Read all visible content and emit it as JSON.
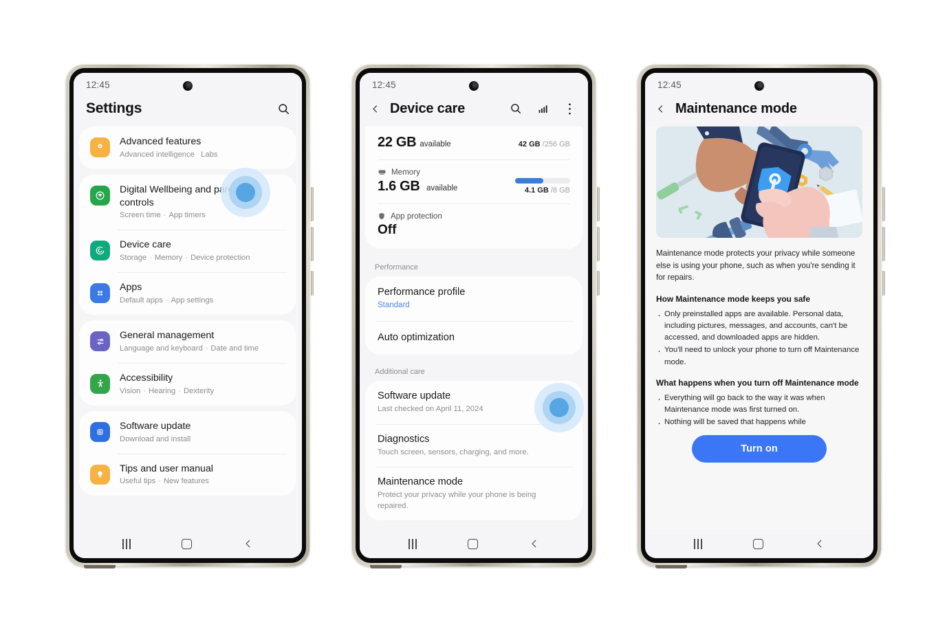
{
  "phones": [
    {
      "id": "settings",
      "status": {
        "time": "12:45"
      },
      "header": {
        "title": "Settings",
        "search_icon": "search-icon"
      },
      "groups": [
        {
          "rows": [
            {
              "title": "Advanced features",
              "sub": [
                "Advanced intelligence",
                "Labs"
              ],
              "sep": "   ",
              "icon": "advanced-features-icon",
              "color": "#f6b343"
            }
          ]
        },
        {
          "rows": [
            {
              "title": "Digital Wellbeing and parental controls",
              "sub": [
                "Screen time",
                "App timers"
              ],
              "sep": " · ",
              "icon": "digital-wellbeing-icon",
              "color": "#27a54b"
            },
            {
              "title": "Device care",
              "sub": [
                "Storage",
                "Memory",
                "Device protection"
              ],
              "sep": " · ",
              "icon": "device-care-icon",
              "color": "#0fa97f"
            },
            {
              "title": "Apps",
              "sub": [
                "Default apps",
                "App settings"
              ],
              "sep": " · ",
              "icon": "apps-icon",
              "color": "#3b7ae4"
            }
          ]
        },
        {
          "rows": [
            {
              "title": "General management",
              "sub": [
                "Language and keyboard",
                "Date and time"
              ],
              "sep": " · ",
              "icon": "general-management-icon",
              "color": "#6b63c4"
            },
            {
              "title": "Accessibility",
              "sub": [
                "Vision",
                "Hearing",
                "Dexterity"
              ],
              "sep": " · ",
              "icon": "accessibility-icon",
              "color": "#35a549"
            }
          ]
        },
        {
          "rows": [
            {
              "title": "Software update",
              "sub": [
                "Download and install"
              ],
              "sep": " · ",
              "icon": "software-update-icon",
              "color": "#2f6fe0"
            },
            {
              "title": "Tips and user manual",
              "sub": [
                "Useful tips",
                "New features"
              ],
              "sep": " · ",
              "icon": "tips-icon",
              "color": "#f6b343"
            }
          ]
        }
      ],
      "touch_hint": "device-care-row"
    },
    {
      "id": "device-care",
      "status": {
        "time": "12:45"
      },
      "header": {
        "title": "Device care",
        "icons": [
          "search-icon",
          "chart-icon",
          "overflow-menu-icon"
        ]
      },
      "storage": {
        "value": "22 GB",
        "suffix": "available",
        "used": "42 GB",
        "total": "/256 GB"
      },
      "memory": {
        "label": "Memory",
        "value": "1.6 GB",
        "suffix": "available",
        "used": "4.1 GB",
        "total": "/8 GB",
        "bar_percent": 51
      },
      "app_protection": {
        "label": "App protection",
        "value": "Off"
      },
      "sections": [
        {
          "label": "Performance",
          "rows": [
            {
              "title": "Performance profile",
              "sub": "Standard",
              "sub_style": "blue"
            },
            {
              "title": "Auto optimization",
              "sub": ""
            }
          ]
        },
        {
          "label": "Additional care",
          "rows": [
            {
              "title": "Software update",
              "sub": "Last checked on April 11, 2024",
              "sub_style": "gray"
            },
            {
              "title": "Diagnostics",
              "sub": "Touch screen, sensors, charging, and more.",
              "sub_style": "gray"
            },
            {
              "title": "Maintenance mode",
              "sub": "Protect your privacy while your phone is being repaired.",
              "sub_style": "gray"
            }
          ]
        }
      ],
      "touch_hint": "maintenance-mode-row"
    },
    {
      "id": "maintenance-mode",
      "status": {
        "time": "12:45"
      },
      "header": {
        "title": "Maintenance mode",
        "back_icon": "back-chevron-icon"
      },
      "illustration": "maintenance-illustration",
      "intro": "Maintenance mode protects your privacy while someone else is using your phone, such as when you're sending it for repairs.",
      "section1": {
        "heading": "How Maintenance mode keeps you safe",
        "bullets": [
          "Only preinstalled apps are available. Personal data, including pictures, messages, and accounts, can't be accessed, and downloaded apps are hidden.",
          "You'll need to unlock your phone to turn off Maintenance mode."
        ]
      },
      "section2": {
        "heading": "What happens when you turn off Maintenance mode",
        "bullets": [
          "Everything will go back to the way it was when Maintenance mode was first turned on.",
          "Nothing will be saved that happens while"
        ]
      },
      "cta": {
        "label": "Turn on",
        "color": "#3b76f6"
      }
    }
  ],
  "navbar": {
    "recents": "recents-icon",
    "home": "home-icon",
    "back": "back-icon"
  }
}
